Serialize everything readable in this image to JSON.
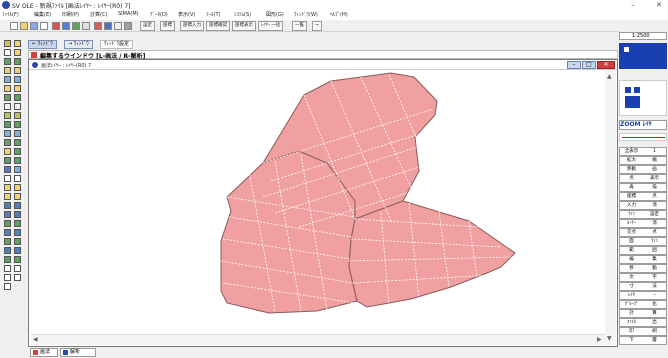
{
  "window": {
    "title": "SV OLE - 新規ﾌｧｲﾙ [画法ﾚｲﾔｰ : ﾚｲﾔｰ(R0) 7]",
    "minimize": "–",
    "close": "✕"
  },
  "menu": [
    "ﾌｧｲﾙ(F)",
    "編集(E)",
    "印刷(P)",
    "計算(C)",
    "SIMA(M)",
    "ﾃﾞｰﾀ(D)",
    "表示(V)",
    "ﾂｰﾙ(T)",
    "ｼｽﾃﾑ(S)",
    "図形(G)",
    "ｳｨﾝﾄﾞｳ(W)",
    "ﾍﾙﾌﾟ(H)"
  ],
  "toolbar": {
    "text_buttons": [
      "設定",
      "座標",
      "座標入力",
      "座標確認",
      "座標表示",
      "ﾚｲﾔｰ 一括",
      "一覧",
      "→"
    ]
  },
  "subbar": {
    "tab1": "← ｳｨﾝﾄﾞｳ",
    "tab2": "→ ｳｨﾝﾄﾞｳ",
    "tab3": "ｳｨﾝﾄﾞｳ設定",
    "pane_title": "編集するウインドウ [L-画法 / R-解析]"
  },
  "child": {
    "title": "画法ﾚｲﾔｰ : ﾚｲﾔｰ(R0) 7",
    "min": "–",
    "max": "□",
    "close": "✕"
  },
  "bottom_tabs": [
    "画法",
    "解析"
  ],
  "right_panel": {
    "scale": "1:2500",
    "zoom": "ZOOM",
    "layer": "ﾚｲﾔ",
    "buttons": [
      [
        "全表示",
        "1"
      ],
      [
        "拡大",
        "縮"
      ],
      [
        "移動",
        "画"
      ],
      [
        "点",
        "表示"
      ],
      [
        "再",
        "描"
      ],
      [
        "座標",
        "点"
      ],
      [
        "入力",
        "消"
      ],
      [
        "ﾗｲﾝ",
        "設定"
      ],
      [
        "ｺｰﾅｰ",
        "消"
      ],
      [
        "交点",
        "点"
      ],
      [
        "面",
        "ﾗｲﾝ"
      ],
      [
        "範",
        "囲"
      ],
      [
        "編",
        "集"
      ],
      [
        "移",
        "動"
      ],
      [
        "文",
        "字"
      ],
      [
        "寸",
        "法"
      ],
      [
        "ﾚｲﾔ",
        "ｰ"
      ],
      [
        "ｸﾞﾙｰﾌﾟ",
        "化"
      ],
      [
        "計",
        "算"
      ],
      [
        "ﾌｧｲﾙ",
        "出"
      ],
      [
        "印",
        "刷"
      ],
      [
        "下",
        "層"
      ]
    ]
  },
  "colors": {
    "parcel_fill": "#f0a0a0",
    "parcel_stroke": "#8a5a5a",
    "blue_accent": "#1a3fb0"
  }
}
